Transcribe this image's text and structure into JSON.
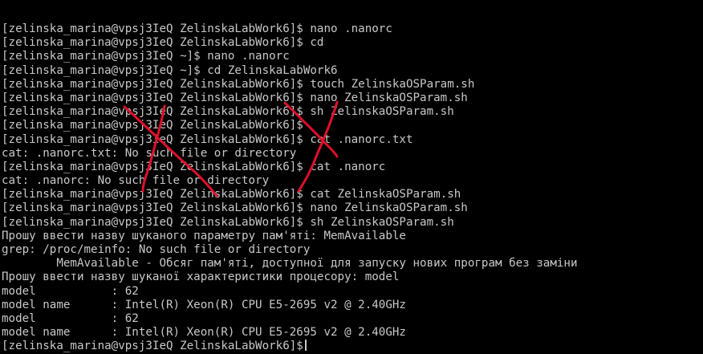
{
  "terminal": {
    "background": "#000000",
    "text_color": "#c8c8c8",
    "annotation_color": "#e0102a",
    "lines": [
      "[zelinska_marina@vpsj3IeQ ZelinskaLabWork6]$ nano .nanorc",
      "[zelinska_marina@vpsj3IeQ ZelinskaLabWork6]$ cd",
      "[zelinska_marina@vpsj3IeQ ~]$ nano .nanorc",
      "[zelinska_marina@vpsj3IeQ ~]$ cd ZelinskaLabWork6",
      "[zelinska_marina@vpsj3IeQ ZelinskaLabWork6]$ touch ZelinskaOSParam.sh",
      "[zelinska_marina@vpsj3IeQ ZelinskaLabWork6]$ nano ZelinskaOSParam.sh",
      "[zelinska_marina@vpsj3IeQ ZelinskaLabWork6]$ sh ZelinskaOSParam.sh",
      "[zelinska_marina@vpsj3IeQ ZelinskaLabWork6]$",
      "[zelinska_marina@vpsj3IeQ ZelinskaLabWork6]$ cat .nanorc.txt",
      "cat: .nanorc.txt: No such file or directory",
      "[zelinska_marina@vpsj3IeQ ZelinskaLabWork6]$ cat .nanorc",
      "cat: .nanorc: No such file or directory",
      "[zelinska_marina@vpsj3IeQ ZelinskaLabWork6]$ cat ZelinskaOSParam.sh",
      "[zelinska_marina@vpsj3IeQ ZelinskaLabWork6]$ nano ZelinskaOSParam.sh",
      "[zelinska_marina@vpsj3IeQ ZelinskaLabWork6]$ sh ZelinskaOSParam.sh",
      "Прошу ввести назву шуканого параметру пам'яті: MemAvailable",
      "grep: /proc/meinfo: No such file or directory",
      "        MemAvailable - Обсяг пам'яті, доступної для запуску нових програм без заміни",
      "Прошу ввести назву шуканої характеристики процесору: model",
      "model           : 62",
      "model name      : Intel(R) Xeon(R) CPU E5-2695 v2 @ 2.40GHz",
      "model           : 62",
      "model name      : Intel(R) Xeon(R) CPU E5-2695 v2 @ 2.40GHz",
      "[zelinska_marina@vpsj3IeQ ZelinskaLabWork6]$"
    ]
  }
}
